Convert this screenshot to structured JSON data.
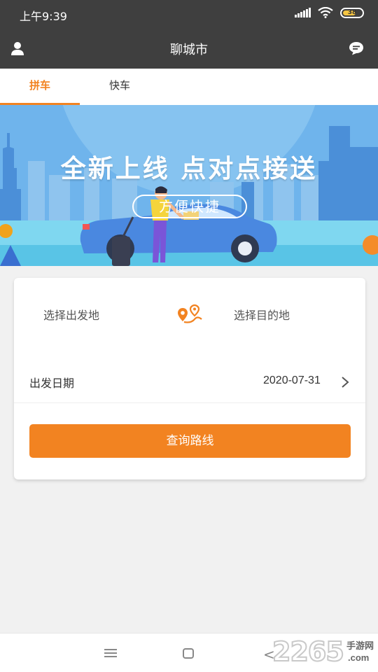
{
  "status_bar": {
    "time": "上午9:39",
    "battery": "38"
  },
  "header": {
    "title": "聊城市",
    "left_icon": "user-icon",
    "right_icon": "chat-bubble-icon"
  },
  "tabs": [
    {
      "label": "拼车",
      "active": true
    },
    {
      "label": "快车",
      "active": false
    }
  ],
  "banner": {
    "headline": "全新上线  点对点接送",
    "pill": "方便快捷"
  },
  "search_card": {
    "origin_placeholder": "选择出发地",
    "destination_placeholder": "选择目的地",
    "date_label": "出发日期",
    "date_value": "2020-07-31",
    "query_button": "查询路线"
  },
  "watermark": {
    "number": "2265",
    "site_cn": "手游网",
    "site_com": ".com"
  },
  "colors": {
    "accent": "#f28321",
    "header_bg": "#3f3f3f",
    "page_bg": "#f1f1f1",
    "banner_sky": "#6fb4ec"
  }
}
